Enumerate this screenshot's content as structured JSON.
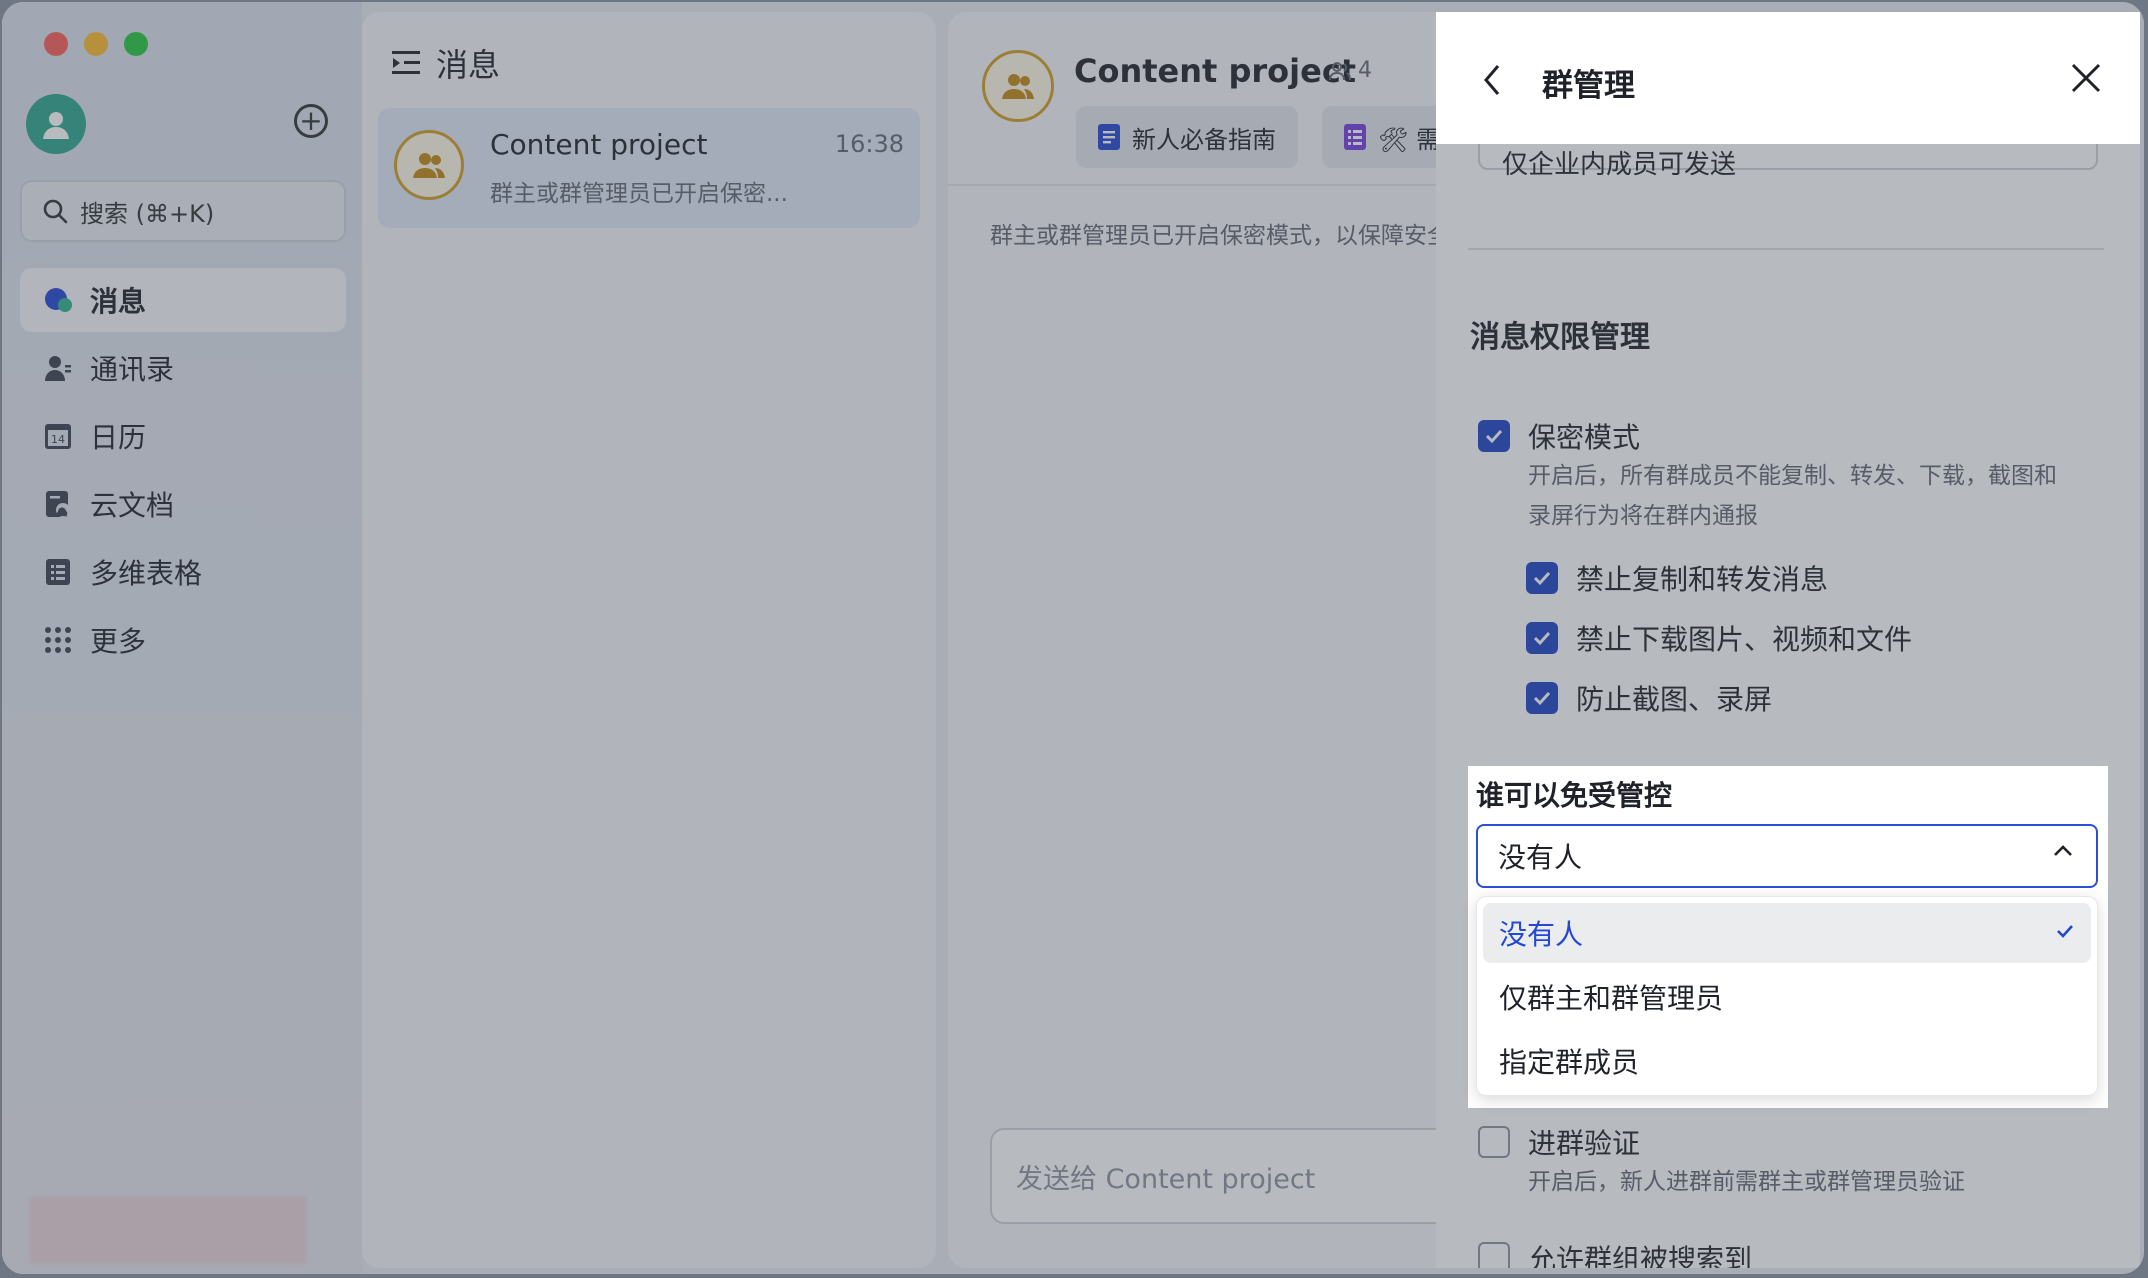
{
  "sidebar": {
    "search_placeholder": "搜索 (⌘+K)",
    "items": [
      {
        "label": "消息",
        "icon": "message-icon",
        "active": true
      },
      {
        "label": "通讯录",
        "icon": "contacts-icon"
      },
      {
        "label": "日历",
        "icon": "calendar-icon",
        "day": "14"
      },
      {
        "label": "云文档",
        "icon": "cloud-docs-icon"
      },
      {
        "label": "多维表格",
        "icon": "base-table-icon"
      },
      {
        "label": "更多",
        "icon": "more-grid-icon"
      }
    ]
  },
  "chat_list": {
    "title": "消息",
    "items": [
      {
        "name": "Content project",
        "time": "16:38",
        "preview": "群主或群管理员已开启保密..."
      }
    ]
  },
  "chat": {
    "title": "Content project",
    "member_count": "4",
    "tabs": [
      {
        "label": "新人必备指南",
        "icon": "doc-icon"
      },
      {
        "label": "🛠 需",
        "icon": "table-icon"
      }
    ],
    "notice": "群主或群管理员已开启保密模式，以保障安全",
    "input_placeholder": "发送给 Content project"
  },
  "panel": {
    "title": "群管理",
    "prev_select_value": "仅企业内成员可发送",
    "section_title": "消息权限管理",
    "secret_mode": {
      "label": "保密模式",
      "checked": true,
      "desc_line1": "开启后，所有群成员不能复制、转发、下载，截图和",
      "desc_line2": "录屏行为将在群内通报"
    },
    "sub_options": [
      {
        "label": "禁止复制和转发消息",
        "checked": true
      },
      {
        "label": "禁止下载图片、视频和文件",
        "checked": true
      },
      {
        "label": "防止截图、录屏",
        "checked": true
      }
    ],
    "exempt": {
      "label": "谁可以免受管控",
      "value": "没有人",
      "options": [
        "没有人",
        "仅群主和群管理员",
        "指定群成员"
      ],
      "selected_index": 0
    },
    "join_verify": {
      "label": "进群验证",
      "checked": false,
      "desc": "开启后，新人进群前需群主或群管理员验证"
    },
    "searchable": {
      "label": "允许群组被搜索到",
      "checked": false
    }
  },
  "colors": {
    "accent": "#1f44c7",
    "avatar_ring": "#d4a025",
    "my_avatar": "#2fa88f"
  }
}
